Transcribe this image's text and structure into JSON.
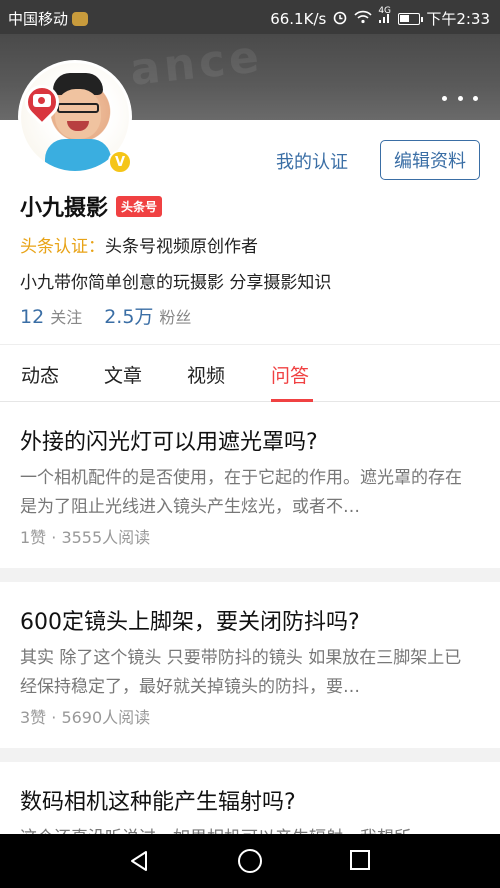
{
  "status_bar": {
    "carrier": "中国移动",
    "speed": "66.1K/s",
    "network": "4G",
    "time": "下午2:33",
    "battery_level": 0.55
  },
  "header": {
    "watermark_text": "ance",
    "back_icon": "chevron-left-icon",
    "more_icon": "more-dots-icon"
  },
  "profile": {
    "verified_badge": "V",
    "my_certification": "我的认证",
    "edit_button": "编辑资料",
    "name": "小九摄影",
    "tag": "头条号",
    "cert_label": "头条认证：",
    "cert_text": "头条号视频原创作者",
    "bio": "小九带你简单创意的玩摄影  分享摄影知识",
    "following_count": "12",
    "following_label": "关注",
    "fans_count": "2.5万",
    "fans_label": "粉丝"
  },
  "tabs": [
    {
      "label": "动态",
      "active": false
    },
    {
      "label": "文章",
      "active": false
    },
    {
      "label": "视频",
      "active": false
    },
    {
      "label": "问答",
      "active": true
    }
  ],
  "feed": [
    {
      "question": "外接的闪光灯可以用遮光罩吗?",
      "answer": "一个相机配件的是否使用，在于它起的作用。遮光罩的存在是为了阻止光线进入镜头产生炫光，或者不…",
      "meta": "1赞 · 3555人阅读"
    },
    {
      "question": "600定镜头上脚架，要关闭防抖吗?",
      "answer": "其实 除了这个镜头 只要带防抖的镜头 如果放在三脚架上已经保持稳定了，最好就关掉镜头的防抖，要…",
      "meta": "3赞 · 5690人阅读"
    },
    {
      "question": "数码相机这种能产生辐射吗?",
      "answer": "这个还真没听说过，如果相机可以产生辐射，我想所",
      "meta": ""
    }
  ],
  "nav_bar": {
    "back_icon": "triangle-back-icon",
    "home_icon": "circle-home-icon",
    "recent_icon": "square-recent-icon"
  }
}
